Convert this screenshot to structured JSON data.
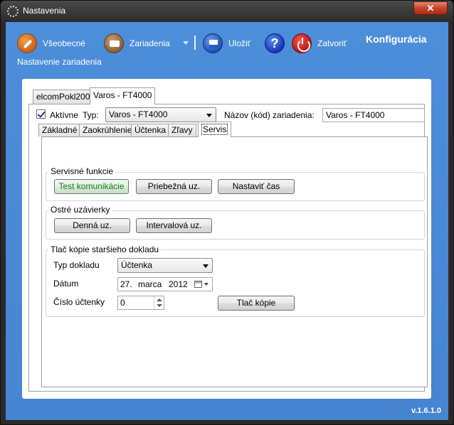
{
  "window": {
    "title": "Nastavenia",
    "close_glyph": "✕"
  },
  "toolbar": {
    "general_label": "Všeobecné",
    "devices_label": "Zariadenia",
    "save_label": "Uložiť",
    "help_glyph": "?",
    "close_label": "Zatvoriť",
    "brand": "Konfigurácia",
    "subtitle": "Nastavenie zariadenia"
  },
  "device_tabs": [
    {
      "label": "elcomPokl200",
      "active": false
    },
    {
      "label": "Varos - FT4000",
      "active": true
    }
  ],
  "device_form": {
    "active_label": "Aktívne",
    "active_checked": true,
    "type_label": "Typ:",
    "type_value": "Varos - FT4000",
    "name_label": "Názov (kód) zariadenia:",
    "name_value": "Varos - FT4000"
  },
  "settings_tabs": [
    {
      "label": "Základné"
    },
    {
      "label": "Zaokrúhlenie"
    },
    {
      "label": "Účtenka"
    },
    {
      "label": "Zľavy"
    },
    {
      "label": "Servis",
      "active": true
    }
  ],
  "service": {
    "group_title": "Servisné funkcie",
    "test_comm": "Test komunikácie",
    "running_report": "Priebežná uz.",
    "set_time": "Nastaviť čas"
  },
  "closures": {
    "group_title": "Ostré uzávierky",
    "daily": "Denná uz.",
    "interval": "Intervalová uz."
  },
  "copy": {
    "group_title": "Tlač kópie staršieho dokladu",
    "doc_type_label": "Typ dokladu",
    "doc_type_value": "Účtenka",
    "date_label": "Dátum",
    "date_day": "27.",
    "date_month": "marca",
    "date_year": "2012",
    "receipt_label": "Číslo účtenky",
    "receipt_value": "0",
    "print_button": "Tlač kópie"
  },
  "version": "v.1.6.1.0"
}
